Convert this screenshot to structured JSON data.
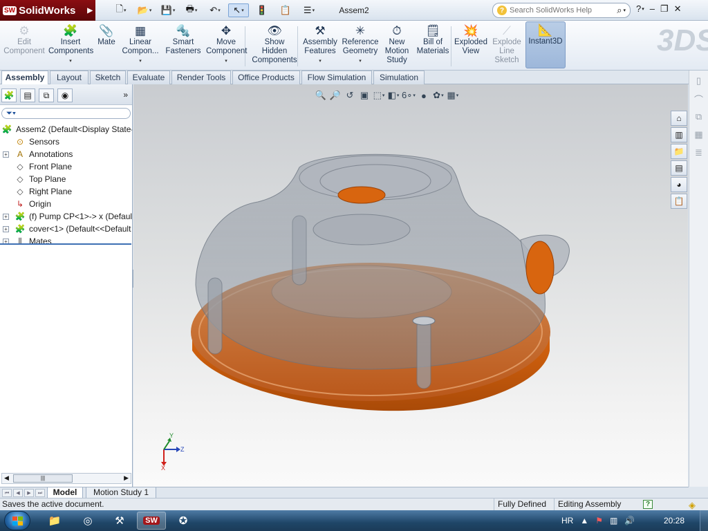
{
  "app": {
    "name": "SolidWorks",
    "document_title": "Assem2",
    "search_placeholder": "Search SolidWorks Help",
    "brand_color": "#8a0e12"
  },
  "command_manager": [
    {
      "id": "edit-component",
      "label": "Edit Component",
      "lines": [
        "Edit",
        "Component"
      ],
      "icon": "edit-component-icon",
      "enabled": false,
      "dropdown": false
    },
    {
      "id": "insert-components",
      "label": "Insert Components",
      "lines": [
        "Insert",
        "Components"
      ],
      "icon": "insert-components-icon",
      "enabled": true,
      "dropdown": true
    },
    {
      "id": "mate",
      "label": "Mate",
      "lines": [
        "Mate"
      ],
      "icon": "paperclip-icon",
      "enabled": true,
      "dropdown": false
    },
    {
      "id": "linear-component-pattern",
      "label": "Linear Compon...",
      "lines": [
        "Linear",
        "Compon..."
      ],
      "icon": "linear-pattern-icon",
      "enabled": true,
      "dropdown": true
    },
    {
      "id": "smart-fasteners",
      "label": "Smart Fasteners",
      "lines": [
        "Smart",
        "Fasteners"
      ],
      "icon": "smart-fasteners-icon",
      "enabled": true,
      "dropdown": false
    },
    {
      "id": "move-component",
      "label": "Move Component",
      "lines": [
        "Move",
        "Component"
      ],
      "icon": "move-component-icon",
      "enabled": true,
      "dropdown": true
    },
    {
      "id": "show-hidden-components",
      "label": "Show Hidden Components",
      "lines": [
        "Show",
        "Hidden",
        "Components"
      ],
      "icon": "show-hidden-icon",
      "enabled": true,
      "dropdown": false
    },
    {
      "id": "assembly-features",
      "label": "Assembly Features",
      "lines": [
        "Assembly",
        "Features"
      ],
      "icon": "assembly-features-icon",
      "enabled": true,
      "dropdown": true
    },
    {
      "id": "reference-geometry",
      "label": "Reference Geometry",
      "lines": [
        "Reference",
        "Geometry"
      ],
      "icon": "reference-geometry-icon",
      "enabled": true,
      "dropdown": true
    },
    {
      "id": "new-motion-study",
      "label": "New Motion Study",
      "lines": [
        "New",
        "Motion",
        "Study"
      ],
      "icon": "motion-study-icon",
      "enabled": true,
      "dropdown": false
    },
    {
      "id": "bill-of-materials",
      "label": "Bill of Materials",
      "lines": [
        "Bill of",
        "Materials"
      ],
      "icon": "bill-of-materials-icon",
      "enabled": true,
      "dropdown": false
    },
    {
      "id": "exploded-view",
      "label": "Exploded View",
      "lines": [
        "Exploded",
        "View"
      ],
      "icon": "exploded-view-icon",
      "enabled": true,
      "dropdown": false
    },
    {
      "id": "explode-line-sketch",
      "label": "Explode Line Sketch",
      "lines": [
        "Explode",
        "Line",
        "Sketch"
      ],
      "icon": "explode-line-sketch-icon",
      "enabled": false,
      "dropdown": false
    },
    {
      "id": "instant3d",
      "label": "Instant3D",
      "lines": [
        "Instant3D"
      ],
      "icon": "instant3d-icon",
      "enabled": true,
      "dropdown": false,
      "active": true
    }
  ],
  "tabs": [
    "Assembly",
    "Layout",
    "Sketch",
    "Evaluate",
    "Render Tools",
    "Office Products",
    "Flow Simulation",
    "Simulation"
  ],
  "active_tab": "Assembly",
  "feature_tree": [
    {
      "label": "Assem2  (Default<Display State-",
      "icon": "assembly-icon",
      "expander": false,
      "indent": 0
    },
    {
      "label": "Sensors",
      "icon": "sensor-icon",
      "expander": false,
      "indent": 1
    },
    {
      "label": "Annotations",
      "icon": "annotations-icon",
      "expander": true,
      "indent": 1
    },
    {
      "label": "Front Plane",
      "icon": "plane-icon",
      "expander": false,
      "indent": 1
    },
    {
      "label": "Top Plane",
      "icon": "plane-icon",
      "expander": false,
      "indent": 1
    },
    {
      "label": "Right Plane",
      "icon": "plane-icon",
      "expander": false,
      "indent": 1
    },
    {
      "label": "Origin",
      "icon": "origin-icon",
      "expander": false,
      "indent": 1
    },
    {
      "label": "(f) Pump CP<1>-> x (Defaul",
      "icon": "part-icon",
      "expander": true,
      "indent": 1
    },
    {
      "label": "cover<1> (Default<<Default",
      "icon": "part-icon",
      "expander": true,
      "indent": 1
    },
    {
      "label": "Mates",
      "icon": "mates-icon",
      "expander": true,
      "indent": 1
    }
  ],
  "bottom_tabs": [
    "Model",
    "Motion Study 1"
  ],
  "active_bottom_tab": "Model",
  "status": {
    "message": "Saves the active document.",
    "definition": "Fully Defined",
    "mode": "Editing Assembly"
  },
  "taskbar": {
    "language": "HR",
    "time": "20:28"
  },
  "triad": {
    "x": "X",
    "y": "Y",
    "z": "Z"
  },
  "colors": {
    "cover_orange": "#c9651a",
    "housing_gray": "#8c94a0",
    "active_command": "#9db7da"
  }
}
